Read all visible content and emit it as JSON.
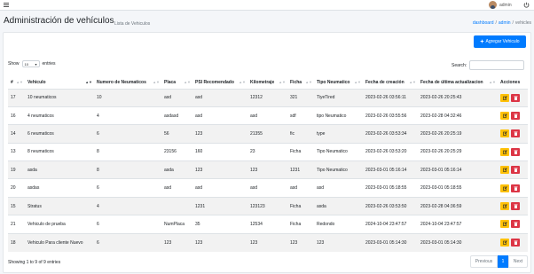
{
  "topbar": {
    "username": "admin"
  },
  "header": {
    "title": "Administración de vehículos",
    "subtitle": "Lista de Vehiculos",
    "breadcrumb": [
      "dashboard",
      "admin",
      "vehicles"
    ]
  },
  "toolbar": {
    "add_label": "Agregar Vehiculo"
  },
  "length_menu": {
    "show_label": "Show",
    "value": "10",
    "entries_label": "entries"
  },
  "search": {
    "label": "Search:",
    "value": ""
  },
  "table": {
    "columns": [
      "#",
      "Vehiculo",
      "Numero de Neumaticos",
      "Placa",
      "PSI Recomendado",
      "Kilometraje",
      "Ficha",
      "Tipo Neumatico",
      "Fecha de creación",
      "Fecha de última actualizacion",
      "Acciones"
    ],
    "rows": [
      [
        "17",
        "10 neumaticos",
        "10",
        "asd",
        "asd",
        "12312",
        "321",
        "TiyeTired",
        "2023-02-26 03:56:11",
        "2023-02-26 20:25:43"
      ],
      [
        "16",
        "4 neumaticos",
        "4",
        "asdasd",
        "asd",
        "asd",
        "sdf",
        "tipo Neumatico",
        "2023-02-26 03:55:56",
        "2023-02-28 04:32:46"
      ],
      [
        "14",
        "6 neumaticos",
        "6",
        "56",
        "123",
        "21355",
        "fic",
        "type",
        "2023-02-26 03:53:34",
        "2023-02-26 20:25:19"
      ],
      [
        "13",
        "8 neumaticos",
        "8",
        "23156",
        "160",
        "23",
        "Ficha",
        "Tipo Neumatico",
        "2023-02-26 03:53:20",
        "2023-02-26 20:25:29"
      ],
      [
        "19",
        "asda",
        "8",
        "asda",
        "123",
        "123",
        "1231",
        "Tipo Neumatico",
        "2023-03-01 05:16:14",
        "2023-03-01 05:16:14"
      ],
      [
        "20",
        "asdas",
        "6",
        "asd",
        "asd",
        "asd",
        "asd",
        "asd",
        "2023-03-01 05:18:55",
        "2023-03-01 05:18:55"
      ],
      [
        "15",
        "Stratus",
        "4",
        "",
        "1231",
        "123123",
        "Ficha",
        "asda",
        "2023-02-26 03:53:50",
        "2023-02-28 04:36:59"
      ],
      [
        "21",
        "Vehiculo de prueba",
        "6",
        "NumPlaca",
        "35",
        "12534",
        "Ficha",
        "Redondo",
        "2024-10-04 23:47:57",
        "2024-10-04 23:47:57"
      ],
      [
        "18",
        "Vehiculo Para cliente Nuevo",
        "6",
        "123",
        "123",
        "123",
        "123",
        "123",
        "2023-03-01 05:14:30",
        "2023-03-01 05:14:30"
      ]
    ]
  },
  "footer": {
    "info": "Showing 1 to 9 of 9 entries",
    "prev_label": "Previous",
    "current_page": "1",
    "next_label": "Next"
  },
  "colors": {
    "primary": "#007bff",
    "edit": "#ffc107",
    "delete": "#dc3545"
  },
  "icons": {
    "edit": "edit-icon",
    "delete": "trash-icon",
    "power": "power-icon",
    "menu": "hamburger-icon"
  }
}
